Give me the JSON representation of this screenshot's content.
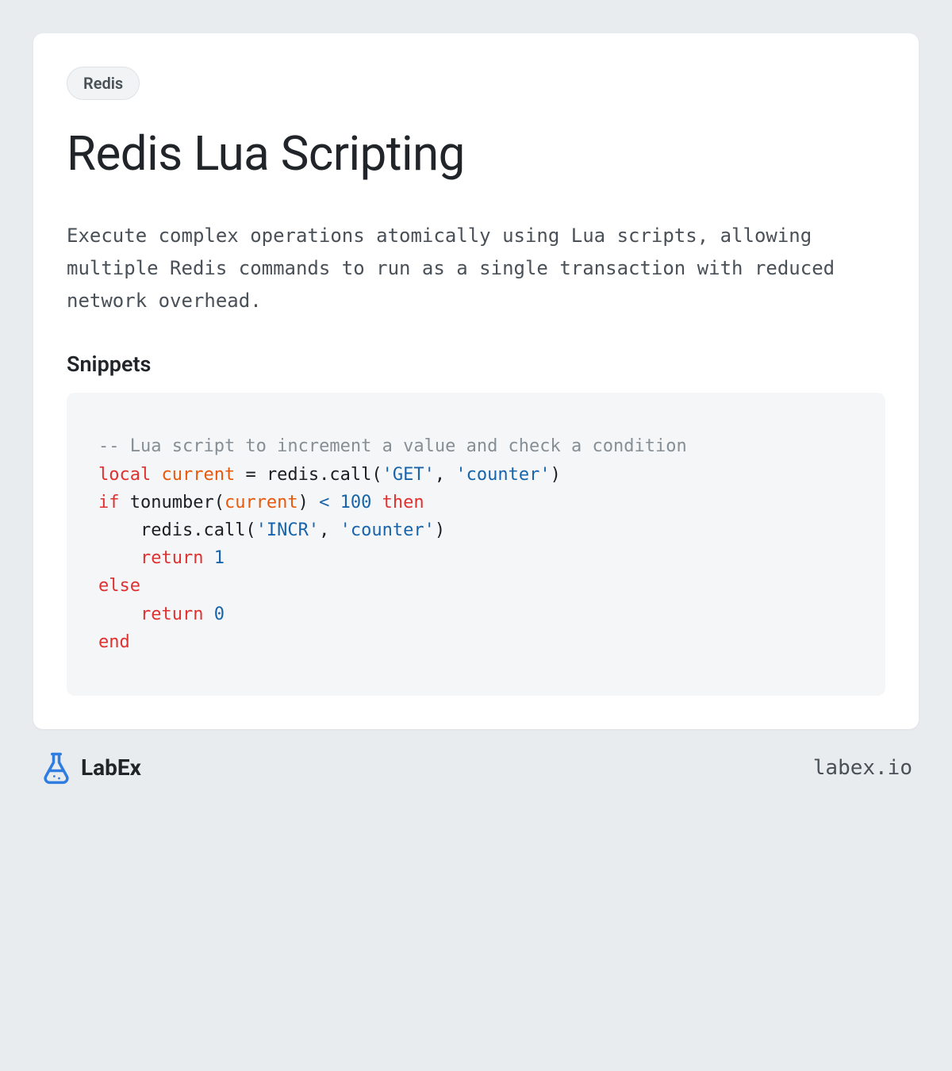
{
  "tag": "Redis",
  "title": "Redis Lua Scripting",
  "description": "Execute complex operations atomically using Lua scripts, allowing multiple Redis commands to run as a single transaction with reduced network overhead.",
  "section_heading": "Snippets",
  "code": {
    "tokens": [
      {
        "t": "-- Lua script to increment a value and check a condition\n",
        "c": "comment"
      },
      {
        "t": "local",
        "c": "keyword"
      },
      {
        "t": " ",
        "c": null
      },
      {
        "t": "current",
        "c": "ident"
      },
      {
        "t": " = redis.call(",
        "c": null
      },
      {
        "t": "'GET'",
        "c": "string"
      },
      {
        "t": ", ",
        "c": null
      },
      {
        "t": "'counter'",
        "c": "string"
      },
      {
        "t": ")\n",
        "c": null
      },
      {
        "t": "if",
        "c": "keyword"
      },
      {
        "t": " tonumber(",
        "c": null
      },
      {
        "t": "current",
        "c": "ident"
      },
      {
        "t": ") ",
        "c": null
      },
      {
        "t": "<",
        "c": "op"
      },
      {
        "t": " ",
        "c": null
      },
      {
        "t": "100",
        "c": "number"
      },
      {
        "t": " ",
        "c": null
      },
      {
        "t": "then",
        "c": "keyword"
      },
      {
        "t": "\n",
        "c": null
      },
      {
        "t": "    redis.call(",
        "c": null
      },
      {
        "t": "'INCR'",
        "c": "string"
      },
      {
        "t": ", ",
        "c": null
      },
      {
        "t": "'counter'",
        "c": "string"
      },
      {
        "t": ")\n",
        "c": null
      },
      {
        "t": "    ",
        "c": null
      },
      {
        "t": "return",
        "c": "keyword"
      },
      {
        "t": " ",
        "c": null
      },
      {
        "t": "1",
        "c": "number"
      },
      {
        "t": "\n",
        "c": null
      },
      {
        "t": "else",
        "c": "keyword"
      },
      {
        "t": "\n",
        "c": null
      },
      {
        "t": "    ",
        "c": null
      },
      {
        "t": "return",
        "c": "keyword"
      },
      {
        "t": " ",
        "c": null
      },
      {
        "t": "0",
        "c": "number"
      },
      {
        "t": "\n",
        "c": null
      },
      {
        "t": "end",
        "c": "keyword"
      }
    ]
  },
  "footer": {
    "brand": "LabEx",
    "url": "labex.io"
  },
  "colors": {
    "page_bg": "#e9ecef",
    "card_bg": "#ffffff",
    "tag_bg": "#f1f3f5",
    "code_bg": "#f5f6f7",
    "accent": "#2f7de1"
  }
}
